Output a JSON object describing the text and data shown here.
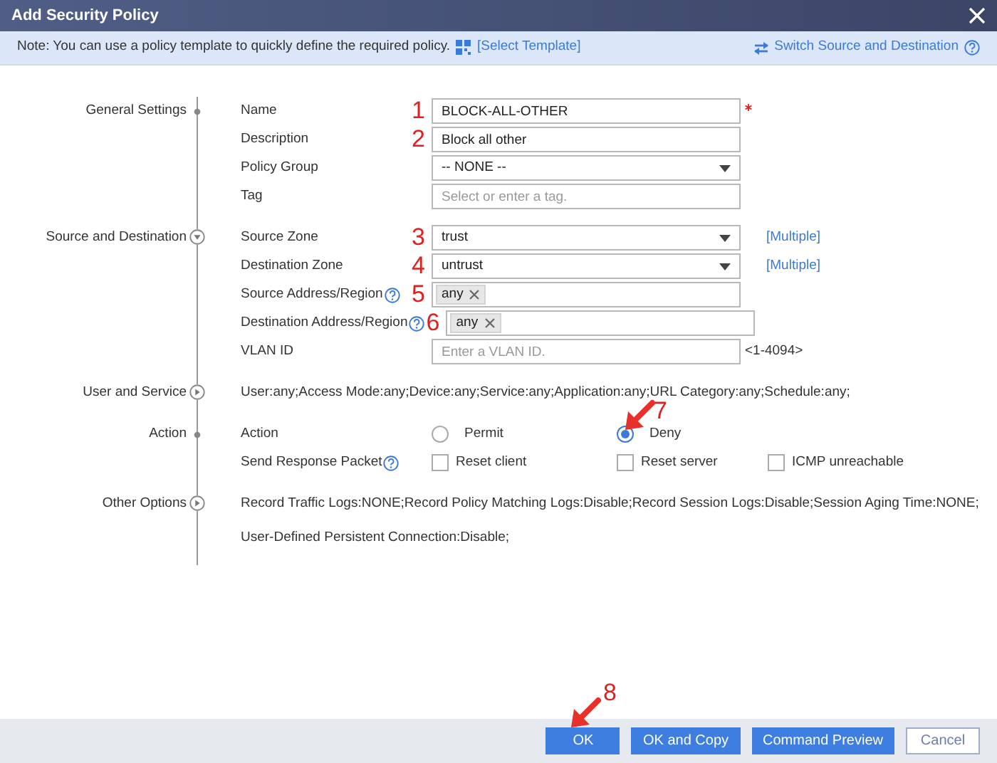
{
  "window": {
    "title": "Add Security Policy"
  },
  "note": {
    "text": "Note: You can use a policy template to quickly define the required policy.",
    "template_link": "[Select Template]",
    "switch_link": "Switch Source and Destination"
  },
  "sections": [
    {
      "title": "General Settings",
      "kind": "fixed",
      "fields": [
        {
          "kind": "text",
          "label": "Name",
          "value": "BLOCK-ALL-OTHER",
          "required": true,
          "callout": "1"
        },
        {
          "kind": "text",
          "label": "Description",
          "value": "Block all other",
          "callout": "2"
        },
        {
          "kind": "select",
          "label": "Policy Group",
          "value": "-- NONE --"
        },
        {
          "kind": "text",
          "label": "Tag",
          "placeholder": "Select or enter a tag."
        }
      ]
    },
    {
      "title": "Source and Destination",
      "kind": "toggle",
      "expanded": true,
      "fields": [
        {
          "kind": "select",
          "label": "Source Zone",
          "value": "trust",
          "callout": "3",
          "link": "[Multiple]"
        },
        {
          "kind": "select",
          "label": "Destination Zone",
          "value": "untrust",
          "callout": "4",
          "link": "[Multiple]"
        },
        {
          "kind": "tags",
          "label": "Source Address/Region",
          "help": true,
          "tags": [
            "any"
          ],
          "callout": "5"
        },
        {
          "kind": "tags",
          "label": "Destination Address/Region",
          "help": true,
          "tags": [
            "any"
          ],
          "callout": "6"
        },
        {
          "kind": "text",
          "label": "VLAN ID",
          "placeholder": "Enter a VLAN ID.",
          "hint": "<1-4094>"
        }
      ]
    },
    {
      "title": "User and Service",
      "kind": "toggle",
      "expanded": false,
      "fields": [
        {
          "kind": "summary",
          "lines": [
            "User:any;Access Mode:any;Device:any;Service:any;Application:any;URL Category:any;Schedule:any;"
          ]
        }
      ]
    },
    {
      "title": "Action",
      "kind": "fixed",
      "fields": [
        {
          "kind": "radio",
          "label": "Action",
          "options": [
            {
              "label": "Permit",
              "selected": false
            },
            {
              "label": "Deny",
              "selected": true,
              "callout": "7"
            }
          ]
        },
        {
          "kind": "checkboxes",
          "label": "Send Response Packet",
          "help": true,
          "options": [
            {
              "label": "Reset client",
              "checked": false
            },
            {
              "label": "Reset server",
              "checked": false
            },
            {
              "label": "ICMP unreachable",
              "checked": false
            }
          ]
        }
      ]
    },
    {
      "title": "Other Options",
      "kind": "toggle",
      "expanded": false,
      "fields": [
        {
          "kind": "summary",
          "lines": [
            "Record Traffic Logs:NONE;Record Policy Matching Logs:Disable;Record Session Logs:Disable;Session Aging Time:NONE;",
            "User-Defined Persistent Connection:Disable;"
          ]
        }
      ]
    }
  ],
  "buttons": [
    {
      "label": "OK",
      "kind": "primary",
      "callout": "8"
    },
    {
      "label": "OK and Copy",
      "kind": "primary"
    },
    {
      "label": "Command Preview",
      "kind": "primary"
    },
    {
      "label": "Cancel",
      "kind": "secondary"
    }
  ]
}
